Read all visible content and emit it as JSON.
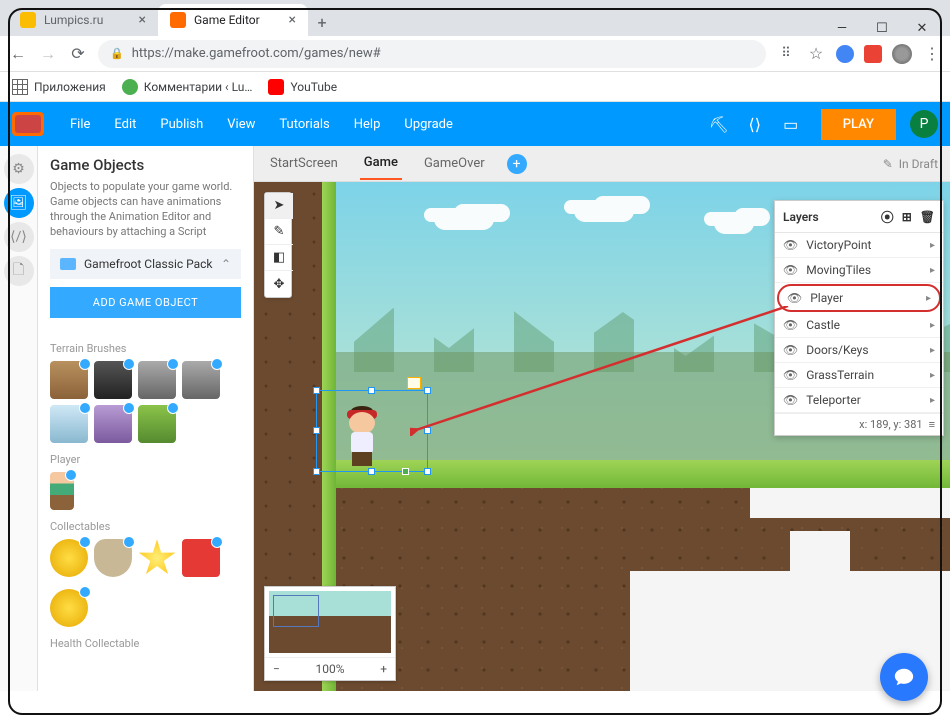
{
  "browser": {
    "tabs": [
      {
        "title": "Lumpics.ru"
      },
      {
        "title": "Game Editor"
      }
    ],
    "url": "https://make.gamefroot.com/games/new#",
    "bookmarks": [
      {
        "label": "Приложения"
      },
      {
        "label": "Комментарии ‹ Lu…"
      },
      {
        "label": "YouTube"
      }
    ]
  },
  "menu": {
    "items": [
      "File",
      "Edit",
      "Publish",
      "View",
      "Tutorials",
      "Help",
      "Upgrade"
    ],
    "play": "PLAY",
    "user_initial": "P"
  },
  "scenes": {
    "tabs": [
      "StartScreen",
      "Game",
      "GameOver"
    ],
    "active": "Game",
    "draft": "In Draft"
  },
  "panel": {
    "title": "Game Objects",
    "desc": "Objects to populate your game world. Game objects can have animations through the Animation Editor and behaviours by attaching a Script",
    "folder": "Gamefroot Classic Pack",
    "add_button": "ADD GAME OBJECT",
    "sections": {
      "terrain": "Terrain Brushes",
      "player": "Player",
      "collectables": "Collectables",
      "health": "Health Collectable"
    }
  },
  "layers": {
    "title": "Layers",
    "items": [
      "VictoryPoint",
      "MovingTiles",
      "Player",
      "Castle",
      "Doors/Keys",
      "GrassTerrain",
      "Teleporter"
    ],
    "highlighted": "Player",
    "coords": "x: 189, y: 381"
  },
  "minimap": {
    "zoom": "100%"
  }
}
